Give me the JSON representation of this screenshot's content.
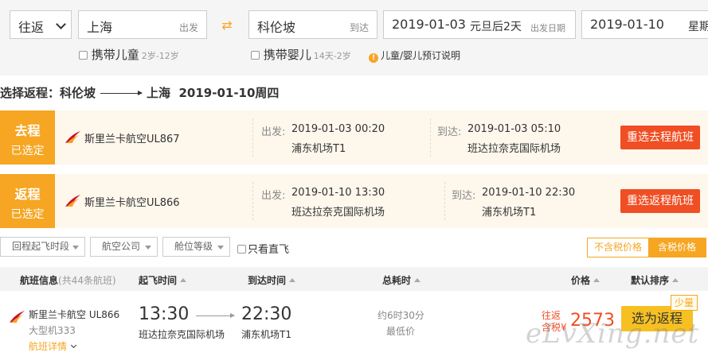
{
  "search": {
    "trip_type": "往返",
    "from_city": "上海",
    "from_hint": "出发",
    "to_city": "科伦坡",
    "to_hint": "到达",
    "depart_date": "2019-01-03",
    "depart_holiday": "元旦后2天",
    "depart_hint": "出发日期",
    "return_date": "2019-01-10",
    "return_weekday": "星期"
  },
  "options": {
    "child_label": "携带儿童",
    "child_age": "2岁-12岁",
    "infant_label": "携带婴儿",
    "infant_age": "14天-2岁",
    "info_link": "儿童/婴儿预订说明"
  },
  "return_title": {
    "prefix": "选择返程：科伦坡",
    "dest": "上海",
    "date": "2019-01-10周四"
  },
  "outbound": {
    "tag_top": "去程",
    "tag_bottom": "已选定",
    "airline": "斯里兰卡航空UL867",
    "dep_label": "出发:",
    "dep_time": "2019-01-03 00:20",
    "dep_airport": "浦东机场T1",
    "arr_label": "到达:",
    "arr_time": "2019-01-03 05:10",
    "arr_airport": "班达拉奈克国际机场",
    "button": "重选去程航班"
  },
  "inbound": {
    "tag_top": "返程",
    "tag_bottom": "已选定",
    "airline": "斯里兰卡航空UL866",
    "dep_label": "出发:",
    "dep_time": "2019-01-10 13:30",
    "dep_airport": "班达拉奈克国际机场",
    "arr_label": "到达:",
    "arr_time": "2019-01-10 22:30",
    "arr_airport": "浦东机场T1",
    "button": "重选返程航班"
  },
  "filters": {
    "time": "回程起飞时段",
    "airline": "航空公司",
    "cabin": "舱位等级",
    "direct": "只看直飞",
    "tax_excl": "不含税价格",
    "tax_incl": "含税价格"
  },
  "table": {
    "col_flight": "航班信息",
    "col_count": "(共44条航班)",
    "col_dep": "起飞时间",
    "col_arr": "到达时间",
    "col_dur": "总耗时",
    "col_price": "价格",
    "col_sort": "默认排序"
  },
  "row": {
    "airline": "斯里兰卡航空 UL866",
    "plane": "大型机333",
    "details": "航班详情",
    "dep_time": "13:30",
    "dep_airport": "班达拉奈克国际机场",
    "arr_time": "22:30",
    "arr_airport": "浦东机场T1",
    "duration": "约6时30分",
    "lowest": "最低价",
    "price_tag1": "往返",
    "price_tag2": "含税¥",
    "price": "2573",
    "select_button": "选为返程",
    "few_badge": "少量"
  },
  "watermark": "eLvXing.net",
  "colors": {
    "accent": "#f6a623",
    "danger": "#f04e23"
  }
}
